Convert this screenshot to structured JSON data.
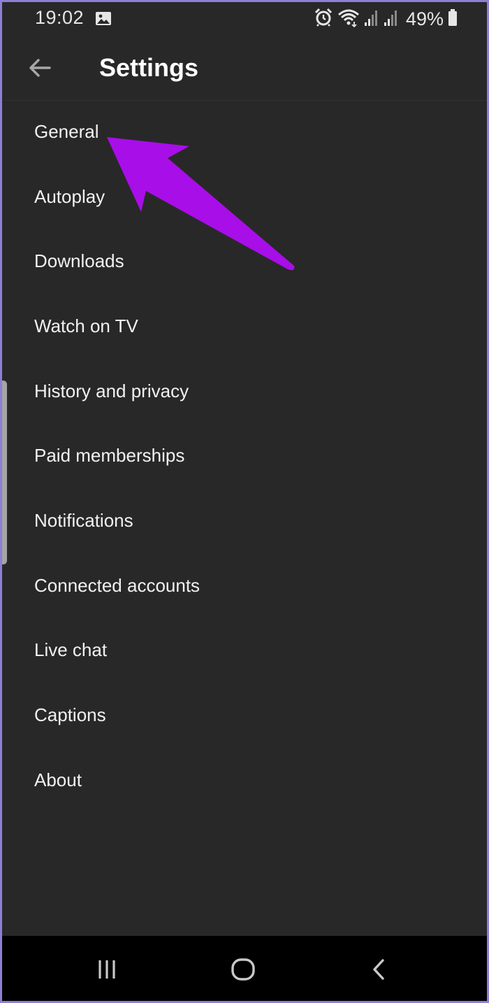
{
  "status_bar": {
    "time": "19:02",
    "battery": "49%",
    "icons": [
      "gallery-icon",
      "alarm-icon",
      "wifi-icon",
      "signal-icon",
      "signal-icon",
      "battery-icon"
    ]
  },
  "header": {
    "title": "Settings",
    "back_icon": "back-arrow-icon"
  },
  "settings": {
    "items": [
      {
        "label": "General"
      },
      {
        "label": "Autoplay"
      },
      {
        "label": "Downloads"
      },
      {
        "label": "Watch on TV"
      },
      {
        "label": "History and privacy"
      },
      {
        "label": "Paid memberships"
      },
      {
        "label": "Notifications"
      },
      {
        "label": "Connected accounts"
      },
      {
        "label": "Live chat"
      },
      {
        "label": "Captions"
      },
      {
        "label": "About"
      }
    ]
  },
  "annotation": {
    "arrow_color": "#a80ee8",
    "points_to": "General"
  },
  "nav_bar": {
    "buttons": [
      "recents-icon",
      "home-icon",
      "back-icon"
    ]
  },
  "colors": {
    "background": "#282828",
    "text": "#f1f1f1",
    "nav_background": "#000000",
    "frame_border": "#8b7fd6"
  }
}
